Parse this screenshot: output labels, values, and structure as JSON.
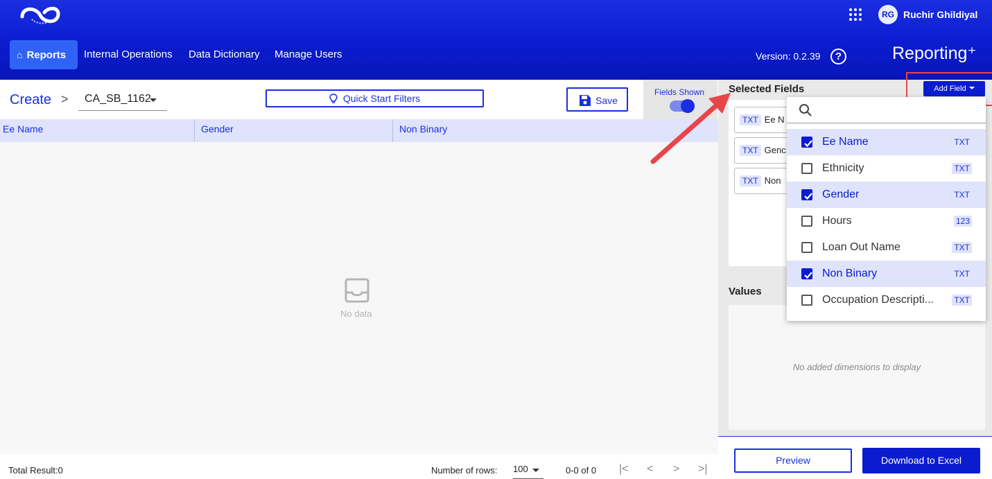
{
  "header": {
    "nav": [
      {
        "label": "Reports",
        "active": true
      },
      {
        "label": "Internal Operations"
      },
      {
        "label": "Data Dictionary"
      },
      {
        "label": "Manage Users"
      }
    ],
    "user_initials": "RG",
    "user_name": "Ruchir Ghildiyal",
    "version": "Version: 0.2.39",
    "brand": "Reporting⁺",
    "help_symbol": "?",
    "icons": [
      "logo",
      "home-icon",
      "apps-grid-icon",
      "help-icon"
    ]
  },
  "toolbar": {
    "breadcrumb": "Create",
    "breadcrumb_sep": ">",
    "report_name": "CA_SB_1162",
    "quick_start": "Quick Start Filters",
    "save": "Save",
    "fields_shown": "Fields Shown",
    "fields_shown_on": true
  },
  "table": {
    "columns": [
      "Ee Name",
      "Gender",
      "Non Binary"
    ],
    "rows": [],
    "empty_text": "No data"
  },
  "footer": {
    "total_result": "Total Result:0",
    "rows_label": "Number of rows:",
    "rows_value": "100",
    "range": "0-0 of 0"
  },
  "selected_fields": {
    "title": "Selected Fields",
    "add_field": "Add Field",
    "chips": [
      {
        "type": "TXT",
        "label": "Ee N"
      },
      {
        "type": "TXT",
        "label": "Genc"
      },
      {
        "type": "TXT",
        "label": "Non"
      }
    ]
  },
  "dropdown": {
    "search_placeholder": "",
    "items": [
      {
        "label": "Ee Name",
        "type": "TXT",
        "checked": true
      },
      {
        "label": "Ethnicity",
        "type": "TXT",
        "checked": false
      },
      {
        "label": "Gender",
        "type": "TXT",
        "checked": true
      },
      {
        "label": "Hours",
        "type": "123",
        "checked": false
      },
      {
        "label": "Loan Out Name",
        "type": "TXT",
        "checked": false
      },
      {
        "label": "Non Binary",
        "type": "TXT",
        "checked": true
      },
      {
        "label": "Occupation Descripti...",
        "type": "TXT",
        "checked": false
      }
    ]
  },
  "values": {
    "title": "Values",
    "empty_text": "No added dimensions to display"
  },
  "actions": {
    "preview": "Preview",
    "download": "Download to Excel"
  },
  "colors": {
    "primary": "#0b1ccf",
    "header_gradient_top": "#1a2fe0",
    "highlight": "#e8454a"
  }
}
